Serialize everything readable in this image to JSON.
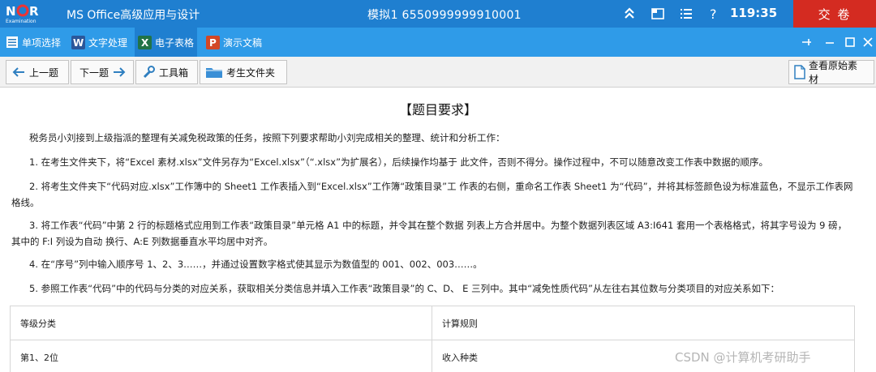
{
  "titlebar": {
    "logo_text": "NCR",
    "logo_sub": "Examination",
    "app_title": "MS Office高级应用与设计",
    "exam_info": "模拟1   6550999999910001",
    "timer": "119:35",
    "submit_label": "交 卷"
  },
  "tabs": [
    {
      "label": "单项选择",
      "icon": "list-icon"
    },
    {
      "label": "文字处理",
      "icon": "word-icon"
    },
    {
      "label": "电子表格",
      "icon": "excel-icon"
    },
    {
      "label": "演示文稿",
      "icon": "powerpoint-icon"
    }
  ],
  "toolbar": {
    "prev_label": "上一题",
    "next_label": "下一题",
    "toolbox_label": "工具箱",
    "folder_label": "考生文件夹",
    "view_source_label": "查看原始素材"
  },
  "content": {
    "heading": "【题目要求】",
    "paragraphs": [
      "税务员小刘接到上级指派的整理有关减免税政策的任务，按照下列要求帮助小刘完成相关的整理、统计和分析工作：",
      "1. 在考生文件夹下，将“Excel 素材.xlsx”文件另存为“Excel.xlsx”（“.xlsx”为扩展名），后续操作均基于 此文件，否则不得分。操作过程中，不可以随意改变工作表中数据的顺序。",
      "2. 将考生文件夹下“代码对应.xlsx”工作簿中的 Sheet1 工作表插入到“Excel.xlsx”工作簿“政策目录”工 作表的右侧，重命名工作表 Sheet1 为“代码”，并将其标签颜色设为标准蓝色，不显示工作表网格线。",
      "3. 将工作表“代码”中第 2 行的标题格式应用到工作表“政策目录”单元格 A1 中的标题，并令其在整个数据 列表上方合并居中。为整个数据列表区域 A3:I641 套用一个表格格式，将其字号设为 9 磅，其中的 F:I 列设为自动 换行、A:E 列数据垂直水平均居中对齐。",
      "4. 在“序号”列中输入顺序号 1、2、3……，并通过设置数字格式使其显示为数值型的 001、002、003……。",
      "5. 参照工作表“代码”中的代码与分类的对应关系，获取相关分类信息并填入工作表“政策目录”的 C、D、 E 三列中。其中“减免性质代码”从左往右其位数与分类项目的对应关系如下："
    ],
    "table": {
      "headers": [
        "等级分类",
        "计算规则"
      ],
      "rows": [
        [
          "第1、2位",
          "收入种类"
        ]
      ]
    }
  },
  "watermark": "CSDN @计算机考研助手",
  "colors": {
    "titlebar": "#1f7fd0",
    "tabbar": "#2f9be8",
    "submit": "#d42b21"
  }
}
